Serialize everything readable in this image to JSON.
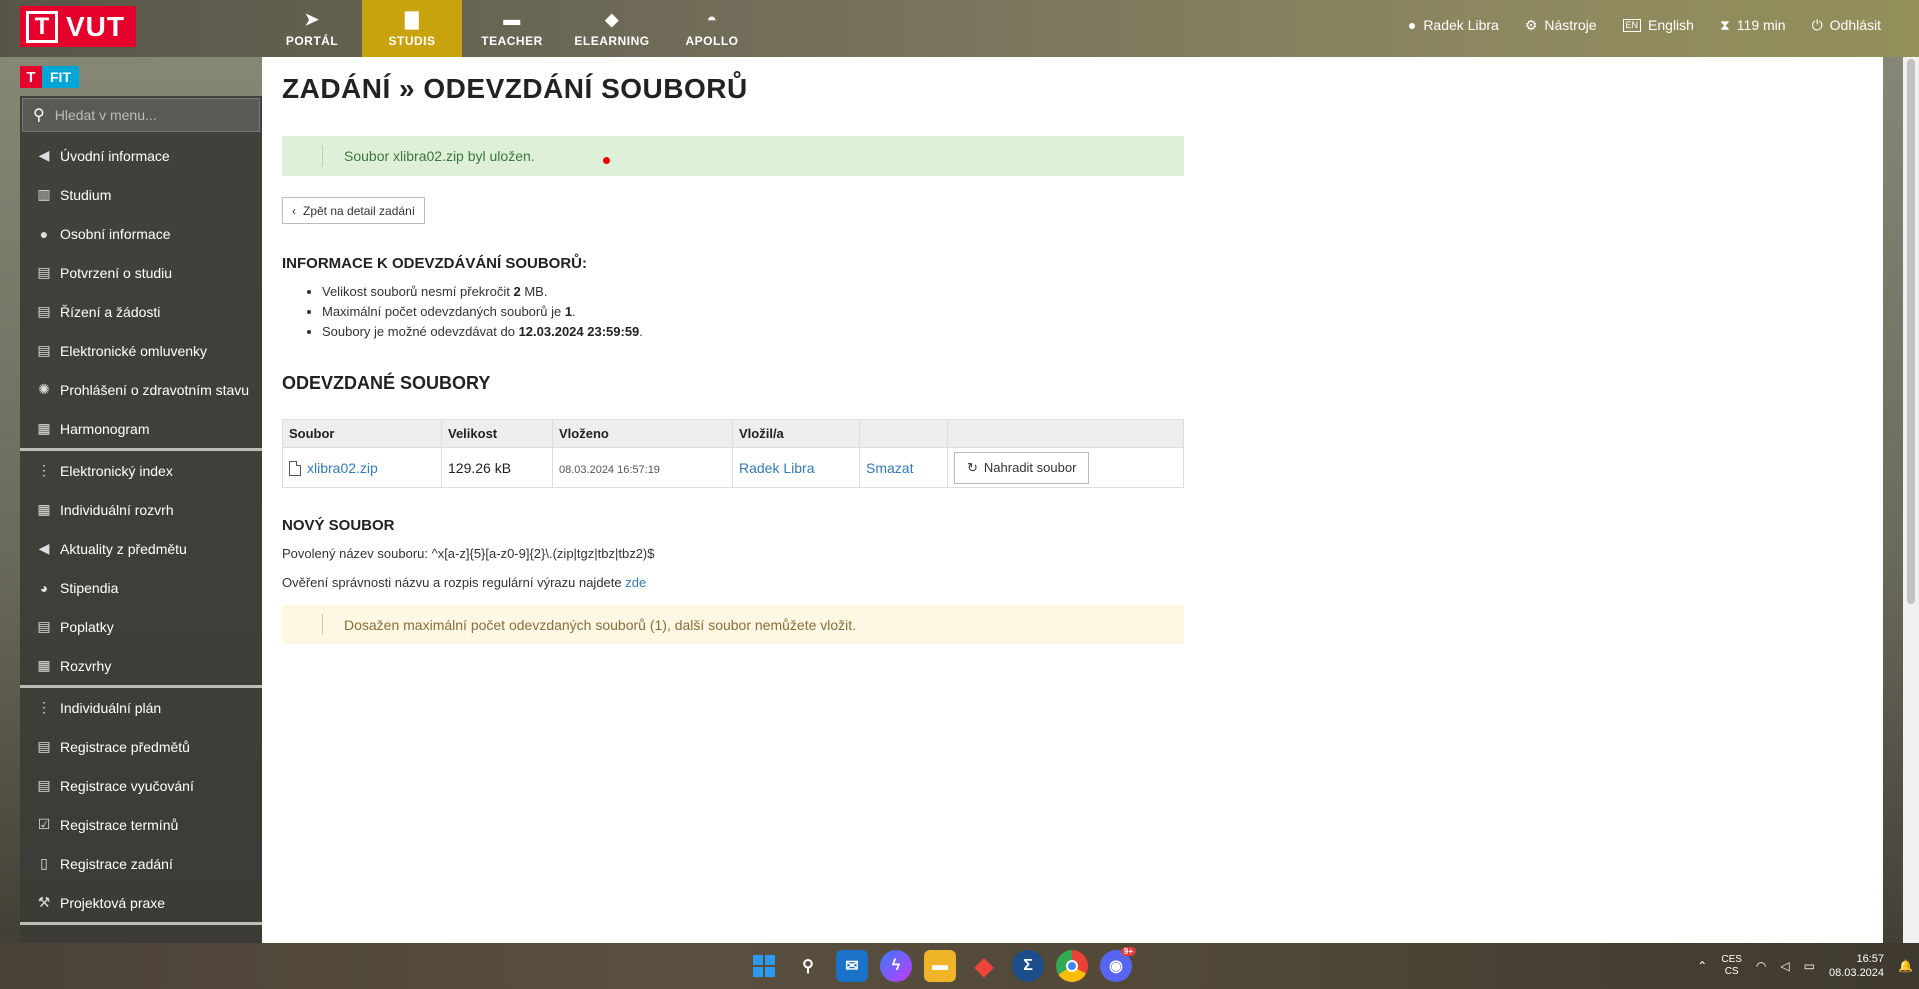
{
  "topbar": {
    "logo": "VUT",
    "nav": [
      {
        "label": "PORTÁL",
        "icon": "navigation-arrow-icon",
        "glyph": "➤"
      },
      {
        "label": "STUDIS",
        "icon": "book-icon",
        "glyph": "▇"
      },
      {
        "label": "TEACHER",
        "icon": "briefcase-icon",
        "glyph": "▬"
      },
      {
        "label": "ELEARNING",
        "icon": "graduation-cap-icon",
        "glyph": "◆"
      },
      {
        "label": "APOLLO",
        "icon": "flame-icon",
        "glyph": "◓"
      }
    ],
    "active_nav": "STUDIS",
    "user": "Radek Libra",
    "tools": "Nástroje",
    "language_badge": "EN",
    "language": "English",
    "session_time": "119 min",
    "logout": "Odhlásit",
    "colors": {
      "active_tab": "#c9a30e",
      "logo_red": "#e4002b",
      "fit_blue": "#00a6d6"
    }
  },
  "sidebar": {
    "fit_logo": "FIT",
    "search_placeholder": "Hledat v menu...",
    "groups": [
      [
        {
          "label": "Úvodní informace",
          "icon": "megaphone-icon",
          "glyph": "◀"
        },
        {
          "label": "Studium",
          "icon": "books-icon",
          "glyph": "▥"
        },
        {
          "label": "Osobní informace",
          "icon": "user-icon",
          "glyph": "●"
        },
        {
          "label": "Potvrzení o studiu",
          "icon": "document-icon",
          "glyph": "▤"
        },
        {
          "label": "Řízení a žádosti",
          "icon": "document-icon",
          "glyph": "▤"
        },
        {
          "label": "Elektronické omluvenky",
          "icon": "document-icon",
          "glyph": "▤"
        },
        {
          "label": "Prohlášení o zdravotním stavu",
          "icon": "virus-icon",
          "glyph": "✺"
        },
        {
          "label": "Harmonogram",
          "icon": "calendar-icon",
          "glyph": "▦"
        }
      ],
      [
        {
          "label": "Elektronický index",
          "icon": "index-icon",
          "glyph": "⋮"
        },
        {
          "label": "Individuální rozvrh",
          "icon": "calendar-icon",
          "glyph": "▦"
        },
        {
          "label": "Aktuality z předmětu",
          "icon": "megaphone-icon",
          "glyph": "◀"
        },
        {
          "label": "Stipendia",
          "icon": "piggy-bank-icon",
          "glyph": "◕"
        },
        {
          "label": "Poplatky",
          "icon": "document-icon",
          "glyph": "▤"
        },
        {
          "label": "Rozvrhy",
          "icon": "calendar-icon",
          "glyph": "▦"
        }
      ],
      [
        {
          "label": "Individuální plán",
          "icon": "plan-icon",
          "glyph": "⋮"
        },
        {
          "label": "Registrace předmětů",
          "icon": "document-icon",
          "glyph": "▤"
        },
        {
          "label": "Registrace vyučování",
          "icon": "document-icon",
          "glyph": "▤"
        },
        {
          "label": "Registrace termínů",
          "icon": "clipboard-check-icon",
          "glyph": "☑"
        },
        {
          "label": "Registrace zadání",
          "icon": "file-icon",
          "glyph": "▯"
        },
        {
          "label": "Projektová praxe",
          "icon": "tools-icon",
          "glyph": "⚒"
        }
      ]
    ]
  },
  "main": {
    "title": "ZADÁNÍ » ODEVZDÁNÍ SOUBORŮ",
    "success_message": "Soubor xlibra02.zip byl uložen.",
    "back_button": "Zpět na detail zadání",
    "info_heading": "INFORMACE K ODEVZDÁVÁNÍ SOUBORŮ:",
    "info": {
      "size_pre": "Velikost souborů nesmí překročit ",
      "size_val": "2",
      "size_post": " MB.",
      "count_pre": "Maximální počet odevzdaných souborů je ",
      "count_val": "1",
      "count_post": ".",
      "deadline_pre": "Soubory je možné odevzdávat do ",
      "deadline_val": "12.03.2024 23:59:59",
      "deadline_post": "."
    },
    "files_heading": "ODEVZDANÉ SOUBORY",
    "table": {
      "headers": [
        "Soubor",
        "Velikost",
        "Vloženo",
        "Vložil/a",
        "",
        ""
      ],
      "rows": [
        {
          "file": "xlibra02.zip",
          "size": "129.26 kB",
          "inserted": "08.03.2024 16:57:19",
          "author": "Radek Libra",
          "delete": "Smazat",
          "replace": "Nahradit soubor"
        }
      ]
    },
    "new_heading": "NOVÝ SOUBOR",
    "allowed_name": "Povolený název souboru: ^x[a-z]{5}[a-z0-9]{2}\\.(zip|tgz|tbz|tbz2)$",
    "verify_pre": "Ověření správnosti názvu a rozpis regulární výrazu najdete ",
    "verify_link": "zde",
    "warning_message": "Dosažen maximální počet odevzdaných souborů (1), další soubor nemůžete vložit."
  },
  "taskbar": {
    "apps": [
      "start-icon",
      "search-icon",
      "mail-icon",
      "messenger-icon",
      "file-explorer-icon",
      "anydesk-icon",
      "sigma-icon",
      "chrome-icon",
      "discord-icon"
    ],
    "discord_badge": "9+",
    "lang_top": "CES",
    "lang_bottom": "CS",
    "time": "16:57",
    "date": "08.03.2024"
  }
}
